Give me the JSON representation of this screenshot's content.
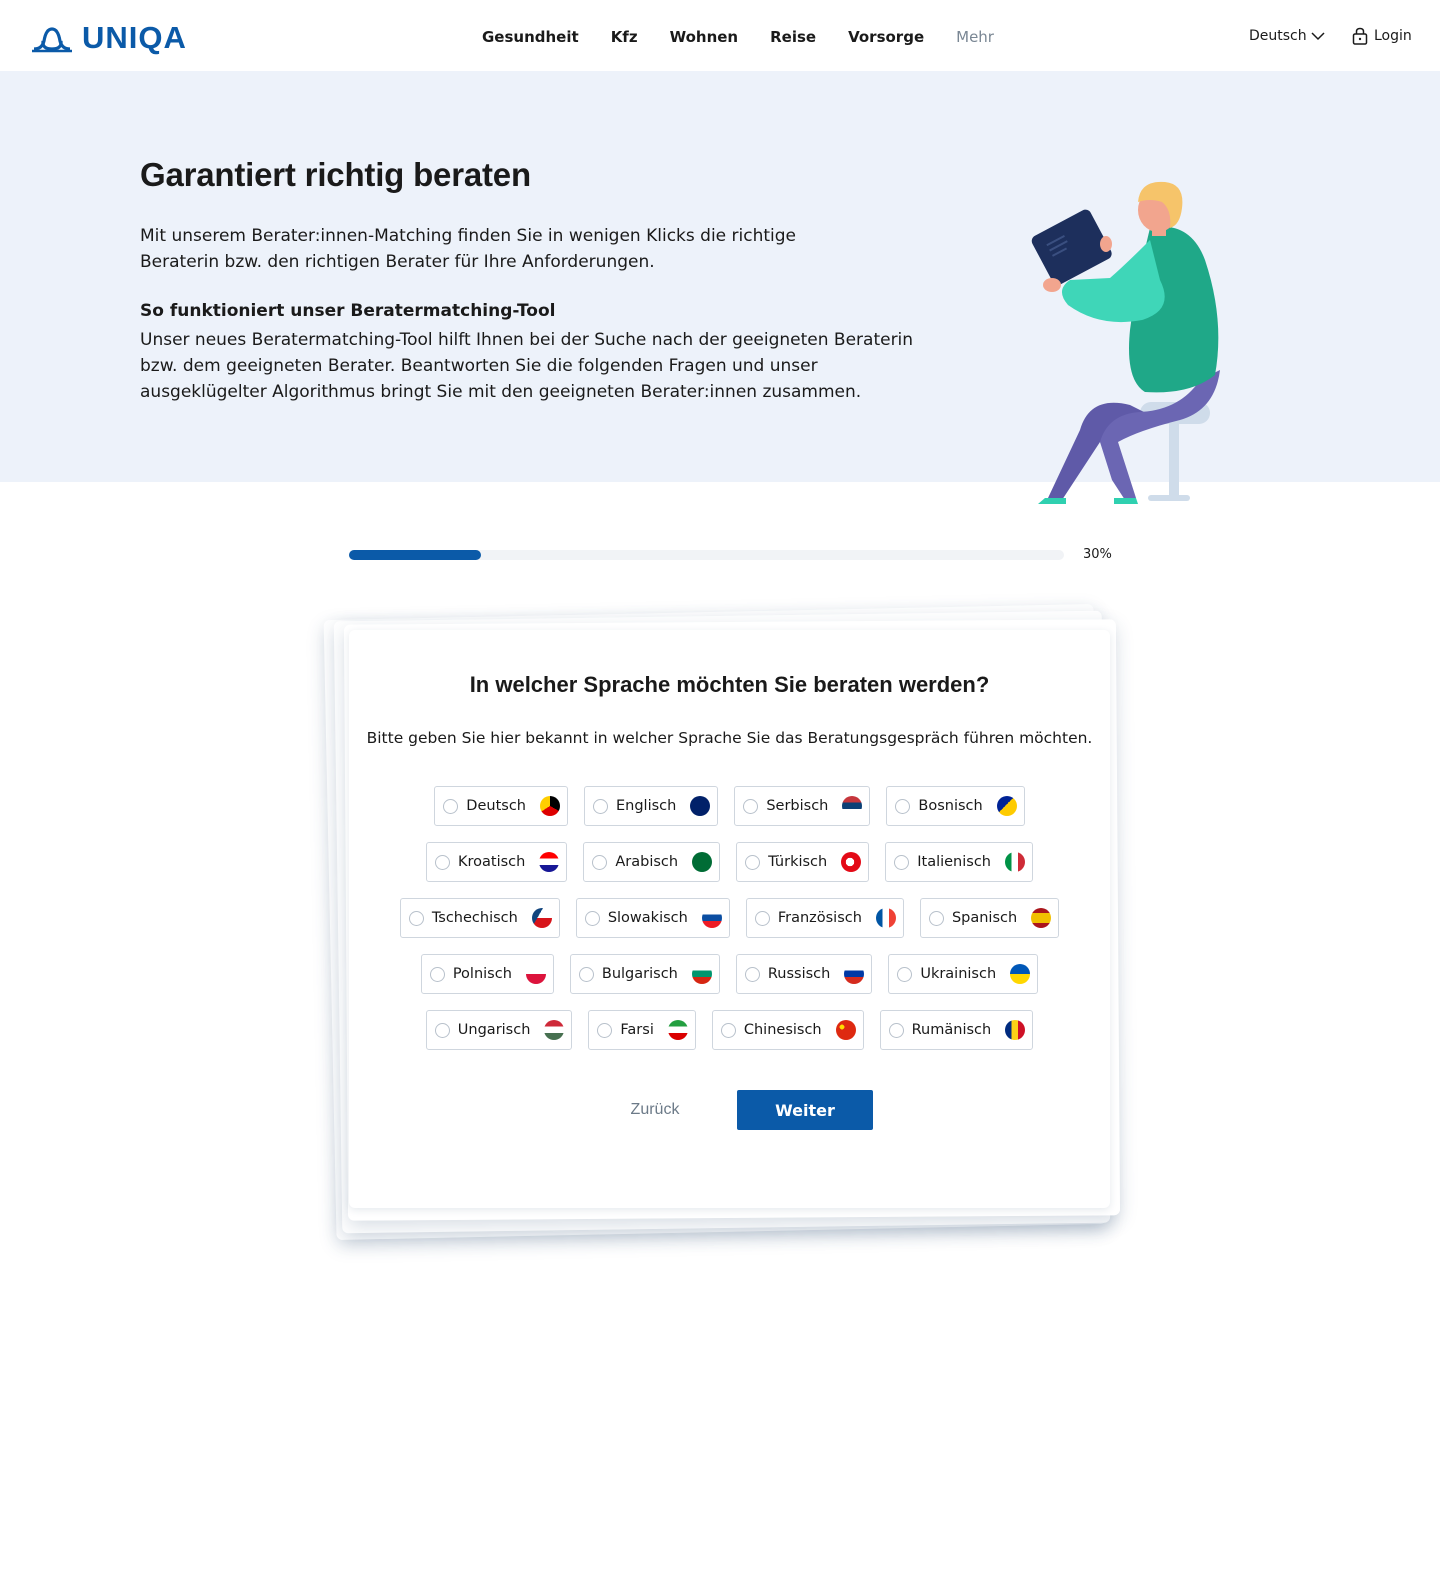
{
  "header": {
    "brand": "UNIQA",
    "nav": [
      "Gesundheit",
      "Kfz",
      "Wohnen",
      "Reise",
      "Vorsorge",
      "Mehr"
    ],
    "language": "Deutsch",
    "login": "Login"
  },
  "hero": {
    "title": "Garantiert richtig beraten",
    "intro": "Mit unserem Berater:innen-Matching finden Sie in wenigen Klicks die richtige Beraterin bzw. den richtigen Berater für Ihre Anforderungen.",
    "subheading": "So funktioniert unser Beratermatching-Tool",
    "body": "Unser neues Beratermatching-Tool hilft Ihnen bei der Suche nach der geeigneten Beraterin bzw. dem geeigneten Berater. Beantworten Sie die folgenden Fragen und unser ausgeklügelter Algorithmus bringt Sie mit den geeigneten Berater:innen zusammen."
  },
  "progress": {
    "value": 0.3,
    "label": "30%"
  },
  "question": {
    "title": "In welcher Sprache möchten Sie beraten werden?",
    "subtitle": "Bitte geben Sie hier bekannt in welcher Sprache Sie das Beratungsgespräch führen möchten.",
    "options": [
      [
        "Deutsch",
        "Englisch",
        "Serbisch",
        "Bosnisch"
      ],
      [
        "Kroatisch",
        "Arabisch",
        "Türkisch",
        "Italienisch"
      ],
      [
        "Tschechisch",
        "Slowakisch",
        "Französisch",
        "Spanisch"
      ],
      [
        "Polnisch",
        "Bulgarisch",
        "Russisch",
        "Ukrainisch"
      ],
      [
        "Ungarisch",
        "Farsi",
        "Chinesisch",
        "Rumänisch"
      ]
    ],
    "back_label": "Zurück",
    "next_label": "Weiter"
  },
  "colors": {
    "brand": "#0b5aa8",
    "hero_bg": "#edf2fa",
    "progress_track": "#f1f3f6"
  }
}
